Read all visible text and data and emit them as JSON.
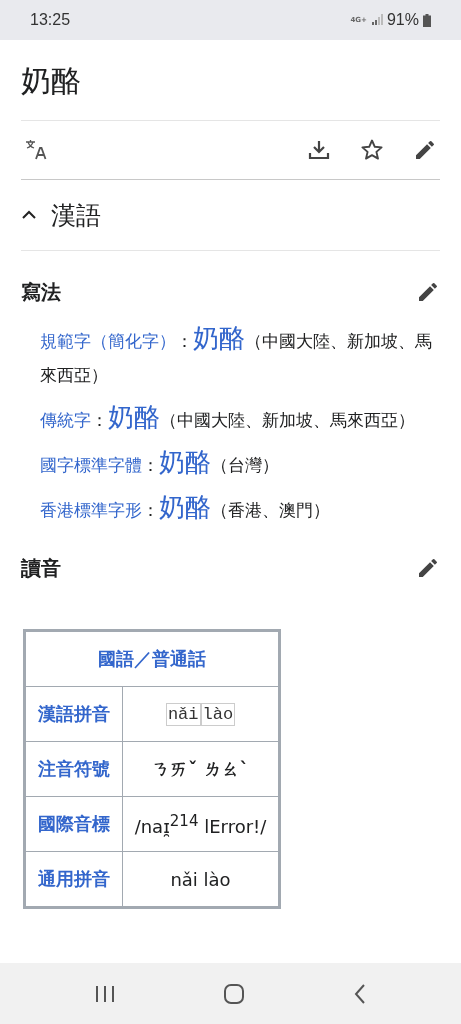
{
  "status_bar": {
    "time": "13:25",
    "network": "4G+",
    "battery": "91%"
  },
  "page_title": "奶酪",
  "section": {
    "title": "漢語",
    "expanded": true
  },
  "writing": {
    "heading": "寫法",
    "forms": [
      {
        "label": "規範字（簡化字）",
        "colon": "：",
        "word": "奶酪",
        "note": "（中國大陸、新加坡、馬來西亞）"
      },
      {
        "label": "傳統字",
        "colon": "：",
        "word": "奶酪",
        "note": "（中國大陸、新加坡、馬來西亞）"
      },
      {
        "label": "國字標準字體",
        "colon": "：",
        "word": "奶酪",
        "note": "（台灣）"
      },
      {
        "label": "香港標準字形",
        "colon": "：",
        "word": "奶酪",
        "note": "（香港、澳門）"
      }
    ]
  },
  "pronunciation": {
    "heading": "讀音",
    "table": {
      "title": "國語／普通話",
      "rows": [
        {
          "label": "漢語拼音",
          "kind": "syllables",
          "syllables": [
            "nǎi",
            "lào"
          ]
        },
        {
          "label": "注音符號",
          "kind": "bold",
          "value": "ㄋㄞˇ ㄌㄠˋ"
        },
        {
          "label": "國際音標",
          "kind": "plain",
          "value": "/naɪ̯$^{214}$ lError!/"
        },
        {
          "label": "通用拼音",
          "kind": "plain",
          "value": "nǎi lào"
        }
      ]
    }
  }
}
